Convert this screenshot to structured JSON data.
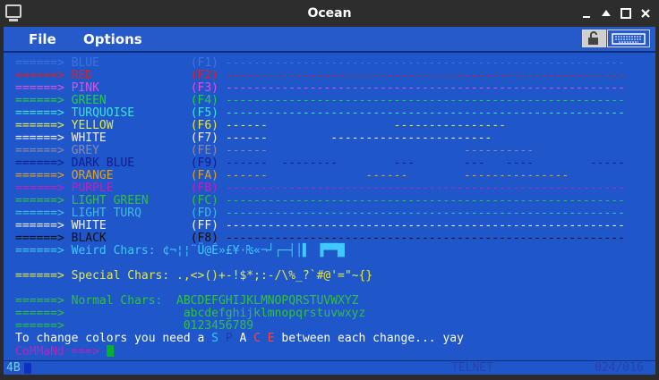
{
  "window": {
    "title": "Ocean"
  },
  "menubar": {
    "file": "File",
    "options": "Options"
  },
  "toolbar": {
    "lock_icon": "lock-icon",
    "keyboard_icon": "keyboard-icon"
  },
  "colors": {
    "blue": "#1e3aa8",
    "red": "#d01010",
    "pink": "#c840c8",
    "green": "#20c030",
    "turquoise": "#30d0d0",
    "yellow": "#d0d030",
    "white": "#e8e8e8",
    "grey": "#8080a0",
    "darkblue": "#1a2a9e",
    "orange": "#d09020",
    "purple": "#c020c0",
    "black": "#101010",
    "cyan": "#30c8ff"
  },
  "terminal": {
    "arrow": "======>",
    "color_rows": [
      {
        "name": "BLUE",
        "key": "(F1)",
        "dash": "--------------------------------------------------------------------------------",
        "color": "#4070e0"
      },
      {
        "name": "RED",
        "key": "(F2)",
        "dash": "--------------------------------------------------------------------------------",
        "color": "#e02020"
      },
      {
        "name": "PINK",
        "key": "(F3)",
        "dash": "--------------------------------------------------------------------------------",
        "color": "#e050e0"
      },
      {
        "name": "GREEN",
        "key": "(F4)",
        "dash": "--------------------------------------------------------------------------------",
        "color": "#20d040"
      },
      {
        "name": "TURQUOISE",
        "key": "(F5)",
        "dash": "--------------------------------------------------------------------------------",
        "color": "#40e0e0"
      },
      {
        "name": "YELLOW",
        "key": "(F6)",
        "dash": "------                  ----------------                                                    ----",
        "color": "#e8e840"
      },
      {
        "name": "WHITE",
        "key": "(F7)",
        "dash": "------         -----------------------                                          ----------",
        "color": "#f0f0f0"
      },
      {
        "name": "GREY",
        "key": "(FE)",
        "dash": "------                            ----------                ----",
        "color": "#8a8aa8"
      },
      {
        "name": "DARK BLUE",
        "key": "(F9)",
        "dash": "------  --------        ---       ---   ----        -----------",
        "color": "#0e1e90"
      },
      {
        "name": "ORANGE",
        "key": "(FA)",
        "dash": "------              ------        ---------------              ----------",
        "color": "#e0a020"
      },
      {
        "name": "PURPLE",
        "key": "(FB)",
        "dash": "--------------------------------------------------------------------------------",
        "color": "#c020c0"
      },
      {
        "name": "LIGHT GREEN",
        "key": "(FC)",
        "dash": "--------------------------------------------------------------------------------",
        "color": "#30c040"
      },
      {
        "name": "LIGHT TURQ",
        "key": "(FD)",
        "dash": "--------------------------------------------------------------------------------",
        "color": "#40b8e0"
      },
      {
        "name": "WHITE",
        "key": "(FF)",
        "dash": "--------------------------------------------------------------------------------",
        "color": "#f0f0f0"
      },
      {
        "name": "BLACK",
        "key": "(F8)",
        "dash": "--------------------------------------------------------------------------------",
        "color": "#101010"
      }
    ],
    "weird_label": "Weird Chars:",
    "weird_chars": "¢¬¦¦¨Ü@Ê»£¥·₨«¬┘┌─┤│▌ ▐▀▀█",
    "special_label": "Special Chars:",
    "special_chars": ".,<>()+-!$*;:-/\\%_?`#@'=\"~{}",
    "normal_label": "Normal Chars:",
    "upper": "ABCDEFGHIJKLMNOPQRSTUVWXYZ",
    "lower": "abcdefghijklmnopqrstuvwxyz",
    "digits": "0123456789",
    "change_prefix": "To change colors you need a ",
    "space_letters": [
      "S",
      "P",
      "A",
      "C",
      "E"
    ],
    "space_colors": [
      "#30c8ff",
      "#1e3aa8",
      "#ffffff",
      "#ff4040",
      "#ff4040"
    ],
    "change_suffix": " between each change... yay",
    "command_label": "CoMMaNd ===>"
  },
  "status": {
    "left": "4B",
    "telnet": "TELNET",
    "position": "024/016"
  }
}
